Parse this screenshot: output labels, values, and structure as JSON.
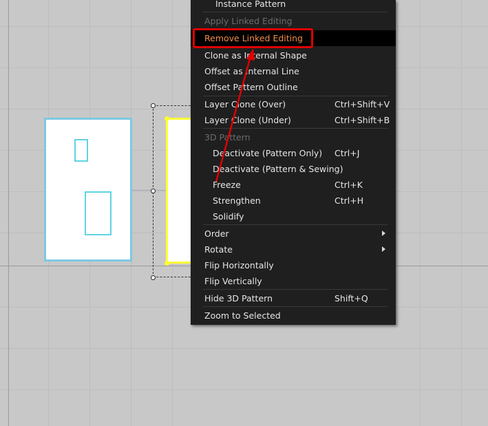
{
  "context_menu": {
    "items": [
      {
        "label": "Instance Pattern",
        "shortcut": "",
        "disabled": false
      },
      {
        "label": "Apply Linked Editing",
        "shortcut": "",
        "disabled": true
      },
      {
        "label": "Remove Linked Editing",
        "shortcut": "",
        "disabled": false,
        "highlighted": true
      },
      {
        "label": "Clone as Internal Shape",
        "shortcut": ""
      },
      {
        "label": "Offset as Internal Line",
        "shortcut": ""
      },
      {
        "label": "Offset Pattern Outline",
        "shortcut": ""
      },
      {
        "label": "Layer Clone (Over)",
        "shortcut": "Ctrl+Shift+V"
      },
      {
        "label": "Layer Clone (Under)",
        "shortcut": "Ctrl+Shift+B"
      },
      {
        "label": "3D Pattern",
        "shortcut": "",
        "disabled": true
      },
      {
        "label": "Deactivate (Pattern Only)",
        "shortcut": "Ctrl+J"
      },
      {
        "label": "Deactivate (Pattern & Sewing)",
        "shortcut": ""
      },
      {
        "label": "Freeze",
        "shortcut": "Ctrl+K"
      },
      {
        "label": "Strengthen",
        "shortcut": "Ctrl+H"
      },
      {
        "label": "Solidify",
        "shortcut": ""
      },
      {
        "label": "Order",
        "shortcut": "",
        "submenu": true
      },
      {
        "label": "Rotate",
        "shortcut": "",
        "submenu": true
      },
      {
        "label": "Flip Horizontally",
        "shortcut": ""
      },
      {
        "label": "Flip Vertically",
        "shortcut": ""
      },
      {
        "label": "Hide 3D Pattern",
        "shortcut": "Shift+Q"
      },
      {
        "label": "Zoom to Selected",
        "shortcut": ""
      }
    ]
  },
  "colors": {
    "canvas_bg": "#c8c8c8",
    "menu_bg": "#1f1f1f",
    "highlight_text": "#f08c45",
    "annotation_red": "#e00000",
    "pattern_outline_blue": "#7ec8e3",
    "selected_outline_yellow": "#ffff33"
  }
}
